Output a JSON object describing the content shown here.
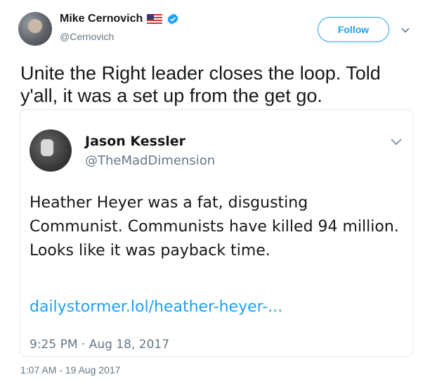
{
  "author": {
    "name": "Mike Cernovich",
    "handle": "@Cernovich"
  },
  "follow_label": "Follow",
  "tweet_text": "Unite the Right leader closes the loop. Told y'all, it was a set up from the get go.",
  "embedded": {
    "name": "Jason Kessler",
    "handle": "@TheMadDimension",
    "text": "Heather Heyer was a fat, disgusting Communist. Communists have killed 94 million. Looks like it was payback time.",
    "link": "dailystormer.lol/heather-heyer-...",
    "time": "9:25 PM · Aug 18, 2017"
  },
  "timestamp": "1:07 AM - 19 Aug 2017",
  "icons": [
    "us-flag-icon",
    "verified-icon",
    "chevron-down-icon"
  ],
  "colors": {
    "accent": "#1da1f2",
    "text": "#14171a",
    "muted": "#657786",
    "border": "#e1e8ed"
  }
}
